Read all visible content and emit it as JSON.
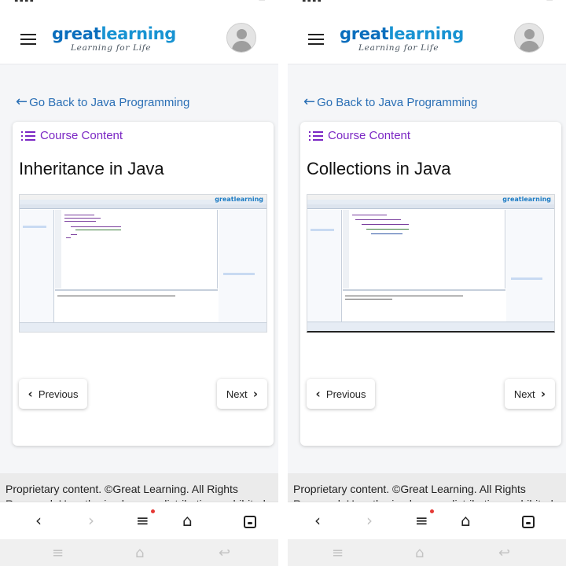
{
  "header": {
    "logo_main": "great",
    "logo_accent": "learning",
    "logo_tagline": "Learning for Life"
  },
  "back_link": {
    "arrow": "←",
    "label": "Go Back to Java Programming"
  },
  "course_content_label": "Course Content",
  "screens": [
    {
      "lesson_title": "Inheritance in Java"
    },
    {
      "lesson_title": "Collections in Java"
    }
  ],
  "video": {
    "brand_watermark": "greatlearning"
  },
  "pagination": {
    "previous_label": "Previous",
    "next_label": "Next",
    "prev_chevron": "‹",
    "next_chevron": "›"
  },
  "footer": {
    "text": "Proprietary content. ©Great Learning. All Rights Reserved. Unauthorized use or distribution prohibited."
  },
  "browser_nav": {
    "back": "‹",
    "forward": "›",
    "menu": "≡",
    "home": "⌂"
  },
  "icons": [
    "hamburger-icon",
    "avatar-icon",
    "back-arrow-icon",
    "list-icon",
    "chevron-left-icon",
    "chevron-right-icon",
    "menu-icon",
    "home-icon",
    "tabs-icon"
  ],
  "colors": {
    "brand_blue": "#0a6ebd",
    "link_blue": "#2a6fb5",
    "course_content_purple": "#7b27c4",
    "notification_dot": "#e53935"
  }
}
